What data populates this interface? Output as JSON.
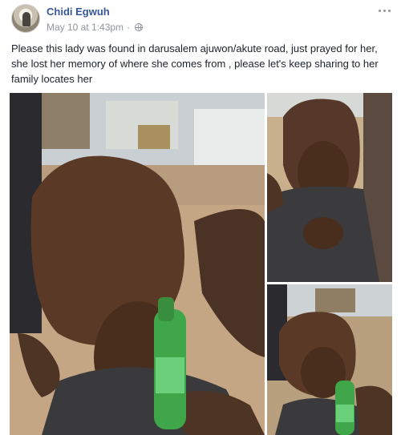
{
  "post": {
    "author": "Chidi Egwuh",
    "timestamp": "May 10 at 1:43pm",
    "separator": "·",
    "audience_icon": "globe-icon",
    "options_icon": "more-options-icon",
    "text": "Please this lady was found in darusalem ajuwon/akute road, just prayed for her, she lost her memory of where she comes from , please let's keep sharing to her family locates her"
  },
  "photos": [
    {
      "name": "main"
    },
    {
      "name": "top-right"
    },
    {
      "name": "bottom-right"
    }
  ],
  "colors": {
    "author_link": "#365899",
    "meta_gray": "#90949c",
    "text": "#1d2129"
  }
}
